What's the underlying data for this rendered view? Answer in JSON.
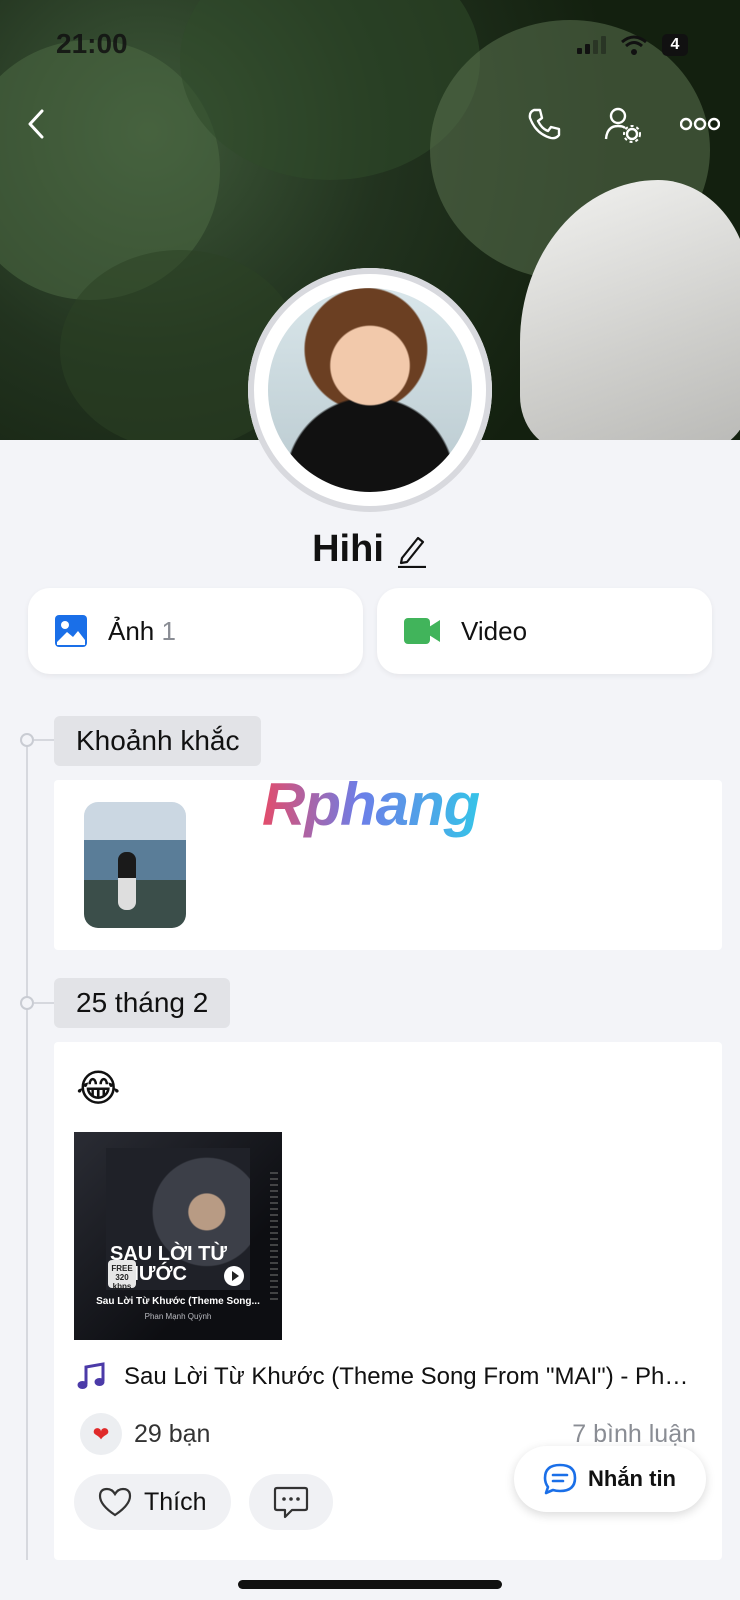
{
  "status_bar": {
    "time": "21:00",
    "battery": "4"
  },
  "profile": {
    "name": "Hihi"
  },
  "media": [
    {
      "label": "Ảnh",
      "count": "1"
    },
    {
      "label": "Video"
    }
  ],
  "timeline": {
    "moments_label": "Khoảnh khắc",
    "date_label": "25 tháng 2"
  },
  "watermark": "Rphang",
  "post": {
    "emoji": "😂",
    "album": {
      "art_title": "SAU LỜI TỪ KHƯỚC",
      "kbps_label": "FREE 320 kbps",
      "song": "Sau Lời Từ Khước (Theme Song...",
      "artist": "Phan Mạnh Quỳnh"
    },
    "song_title": "Sau Lời Từ Khước (Theme Song From \"MAI\") - Phan Mạnh Quỳnh",
    "likes": "29 bạn",
    "comments": "7 bình luận",
    "like_label": "Thích"
  },
  "fab": {
    "label": "Nhắn tin"
  },
  "colors": {
    "accent": "#1a6fe8",
    "video": "#41b45b",
    "heart": "#e02a2a"
  }
}
